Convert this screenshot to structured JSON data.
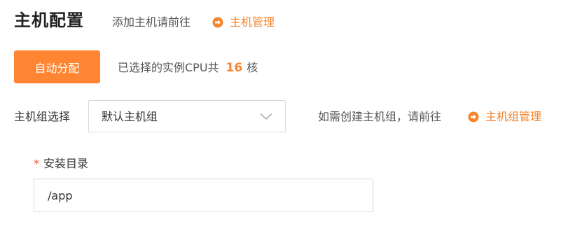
{
  "header": {
    "title": "主机配置",
    "hint": "添加主机请前往",
    "host_link": "主机管理",
    "link_icon": "circle-arrow-right-icon"
  },
  "allocation": {
    "auto_button_label": "自动分配",
    "cpu_prefix": "已选择的实例CPU共",
    "cpu_count": "16",
    "cpu_unit": "核"
  },
  "host_group": {
    "label": "主机组选择",
    "selected": "默认主机组",
    "hint": "如需创建主机组，请前往",
    "manage_link": "主机组管理"
  },
  "install_dir": {
    "required_mark": "*",
    "label": "安装目录",
    "value": "/app"
  },
  "colors": {
    "accent": "#f7832a",
    "button_bg": "#ff8533",
    "required": "#f5502d"
  }
}
